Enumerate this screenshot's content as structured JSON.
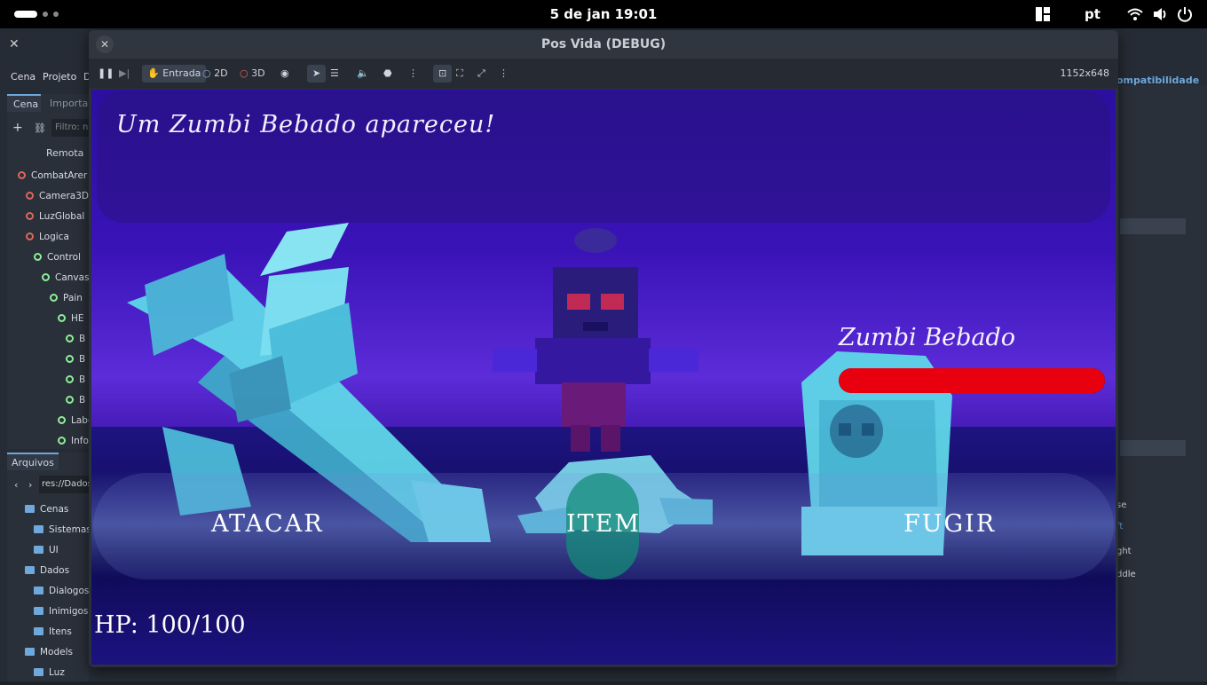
{
  "system_bar": {
    "clock": "5 de jan  19:01",
    "language": "pt"
  },
  "editor": {
    "menu": [
      "Cena",
      "Projeto",
      "D"
    ],
    "scene_tabs": [
      "Cena",
      "Importar"
    ],
    "filter_placeholder": "Filtro: n",
    "remote_label": "Remota",
    "scene_tree": [
      {
        "label": "CombatArer",
        "indent": 0
      },
      {
        "label": "Camera3D",
        "indent": 1
      },
      {
        "label": "LuzGlobal",
        "indent": 1
      },
      {
        "label": "Logica",
        "indent": 1
      },
      {
        "label": "Control",
        "indent": 2
      },
      {
        "label": "Canvas",
        "indent": 3
      },
      {
        "label": "Pain",
        "indent": 4
      },
      {
        "label": "HE",
        "indent": 5
      },
      {
        "label": "B",
        "indent": 6
      },
      {
        "label": "B",
        "indent": 6
      },
      {
        "label": "B",
        "indent": 6
      },
      {
        "label": "B",
        "indent": 6
      },
      {
        "label": "Labe",
        "indent": 5
      },
      {
        "label": "Infol",
        "indent": 5
      }
    ],
    "files_tab": "Arquivos",
    "files_path": "res://Dados",
    "files": [
      {
        "label": "Cenas",
        "indent": 1
      },
      {
        "label": "Sistemas",
        "indent": 2
      },
      {
        "label": "UI",
        "indent": 2
      },
      {
        "label": "Dados",
        "indent": 1
      },
      {
        "label": "Dialogos",
        "indent": 2
      },
      {
        "label": "Inimigos",
        "indent": 2
      },
      {
        "label": "Itens",
        "indent": 2
      },
      {
        "label": "Models",
        "indent": 1
      },
      {
        "label": "Luz",
        "indent": 2
      }
    ],
    "renderer_label": "ompatibilidade",
    "inspector_fragments": [
      "se",
      "ft",
      "ght",
      "ddle"
    ]
  },
  "game_window": {
    "title": "Pos Vida (DEBUG)",
    "toolbar": {
      "input_label": "Entrada",
      "mode_2d": "2D",
      "mode_3d": "3D",
      "resolution": "1152x648"
    }
  },
  "game": {
    "dialog_text": "Um Zumbi Bebado apareceu!",
    "enemy": {
      "name": "Zumbi Bebado",
      "hp_fraction": 1.0
    },
    "actions": {
      "attack": "ATACAR",
      "item": "ITEM",
      "flee": "FUGIR"
    },
    "player_hp": "HP: 100/100",
    "colors": {
      "enemy_hp": "#e8000e",
      "item_highlight": "#148c78"
    }
  }
}
